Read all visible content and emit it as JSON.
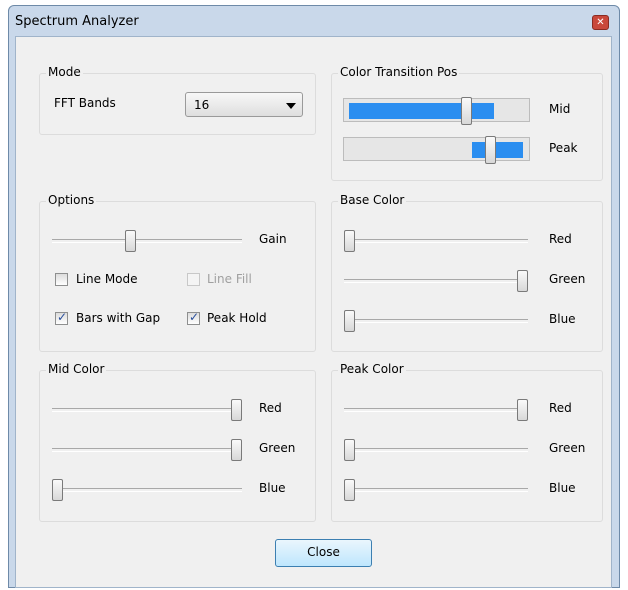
{
  "window": {
    "title": "Spectrum Analyzer"
  },
  "mode": {
    "group_title": "Mode",
    "fft_label": "FFT Bands",
    "fft_value": "16"
  },
  "color_transition": {
    "group_title": "Color Transition Pos",
    "mid_label": "Mid",
    "peak_label": "Peak",
    "mid_value": 0.82,
    "peak_value": 0.82
  },
  "options": {
    "group_title": "Options",
    "gain_label": "Gain",
    "gain_value": 0.41,
    "checkboxes": [
      {
        "label": "Line Mode",
        "checked": false,
        "enabled": true
      },
      {
        "label": "Line Fill",
        "checked": false,
        "enabled": false
      },
      {
        "label": "Bars with Gap",
        "checked": true,
        "enabled": true
      },
      {
        "label": "Peak Hold",
        "checked": true,
        "enabled": true
      }
    ]
  },
  "base_color": {
    "group_title": "Base Color",
    "red_label": "Red",
    "green_label": "Green",
    "blue_label": "Blue",
    "red": 0.0,
    "green": 1.0,
    "blue": 0.0
  },
  "mid_color": {
    "group_title": "Mid Color",
    "red_label": "Red",
    "green_label": "Green",
    "blue_label": "Blue",
    "red": 1.0,
    "green": 1.0,
    "blue": 0.0
  },
  "peak_color": {
    "group_title": "Peak Color",
    "red_label": "Red",
    "green_label": "Green",
    "blue_label": "Blue",
    "red": 1.0,
    "green": 0.0,
    "blue": 0.0
  },
  "close_button": "Close",
  "icons": {
    "close": "close-icon",
    "dropdown": "chevron-down-icon",
    "check": "check-icon"
  },
  "colors": {
    "accent": "#2b8ef0",
    "titlebar": "#c9d8ea",
    "close": "#c9483b"
  }
}
